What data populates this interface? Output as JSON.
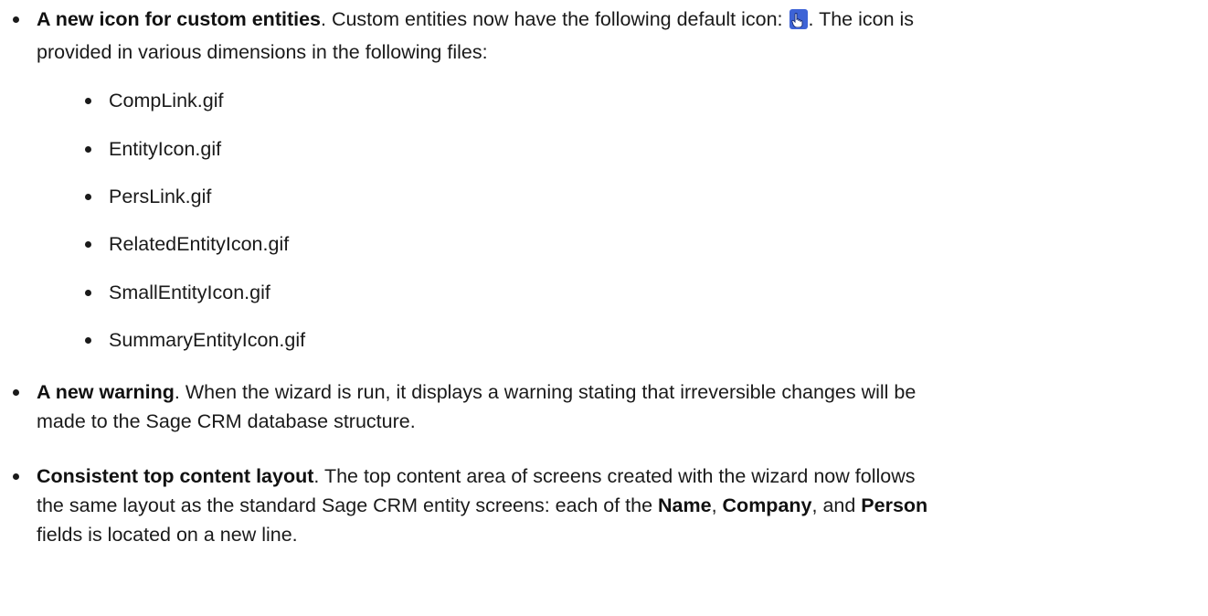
{
  "items": [
    {
      "title": "A new icon for custom entities",
      "text_before_icon": ". Custom entities now have the following default icon: ",
      "icon": "hand-pointer-icon",
      "text_after_icon": ". The icon is",
      "line2": "provided in various dimensions in the following files:",
      "files": [
        "CompLink.gif",
        "EntityIcon.gif",
        "PersLink.gif",
        "RelatedEntityIcon.gif",
        "SmallEntityIcon.gif",
        "SummaryEntityIcon.gif"
      ]
    },
    {
      "title": "A new warning",
      "line1": ". When the wizard is run, it displays a warning stating that irreversible changes will be",
      "line2": "made to the Sage CRM database structure."
    },
    {
      "title": "Consistent top content layout",
      "line1": ". The top content area of screens created with the wizard now follows",
      "line2_a": "the same layout as the standard Sage CRM entity screens: each of the ",
      "name": "Name",
      "sep1": ", ",
      "company": "Company",
      "sep2": ", and ",
      "person": "Person",
      "line3": "fields is located on a new line."
    }
  ],
  "colors": {
    "icon": "#3d63d6",
    "text": "#1a1a1a"
  }
}
